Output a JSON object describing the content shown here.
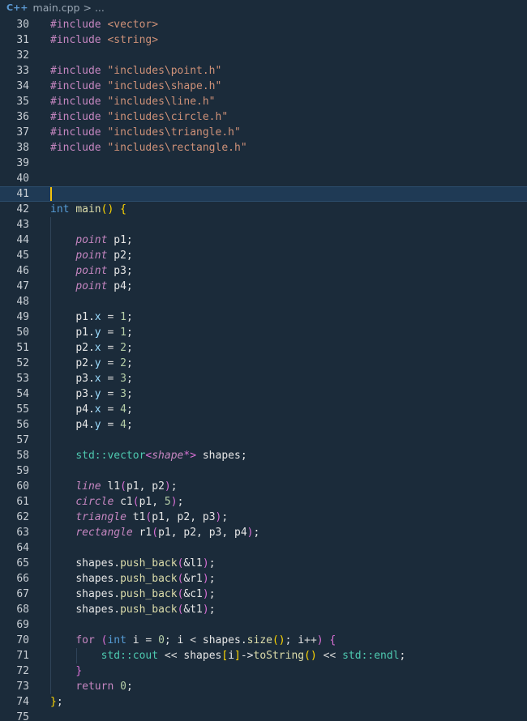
{
  "breadcrumb": {
    "icon": "C++",
    "file": "main.cpp",
    "sep": ">",
    "more": "..."
  },
  "editor": {
    "current_line": 41,
    "lines": [
      {
        "n": "30",
        "tokens": [
          [
            "pp",
            "#include"
          ],
          [
            "op",
            " "
          ],
          [
            "inc",
            "<vector>"
          ]
        ]
      },
      {
        "n": "31",
        "tokens": [
          [
            "pp",
            "#include"
          ],
          [
            "op",
            " "
          ],
          [
            "inc",
            "<string>"
          ]
        ]
      },
      {
        "n": "32",
        "tokens": []
      },
      {
        "n": "33",
        "tokens": [
          [
            "pp",
            "#include"
          ],
          [
            "op",
            " "
          ],
          [
            "incs",
            "\"includes\\point.h\""
          ]
        ]
      },
      {
        "n": "34",
        "tokens": [
          [
            "pp",
            "#include"
          ],
          [
            "op",
            " "
          ],
          [
            "incs",
            "\"includes\\shape.h\""
          ]
        ]
      },
      {
        "n": "35",
        "tokens": [
          [
            "pp",
            "#include"
          ],
          [
            "op",
            " "
          ],
          [
            "incs",
            "\"includes\\line.h\""
          ]
        ]
      },
      {
        "n": "36",
        "tokens": [
          [
            "pp",
            "#include"
          ],
          [
            "op",
            " "
          ],
          [
            "incs",
            "\"includes\\circle.h\""
          ]
        ]
      },
      {
        "n": "37",
        "tokens": [
          [
            "pp",
            "#include"
          ],
          [
            "op",
            " "
          ],
          [
            "incs",
            "\"includes\\triangle.h\""
          ]
        ]
      },
      {
        "n": "38",
        "tokens": [
          [
            "pp",
            "#include"
          ],
          [
            "op",
            " "
          ],
          [
            "incs",
            "\"includes\\rectangle.h\""
          ]
        ]
      },
      {
        "n": "39",
        "tokens": []
      },
      {
        "n": "40",
        "tokens": []
      },
      {
        "n": "41",
        "tokens": []
      },
      {
        "n": "42",
        "tokens": [
          [
            "kwb",
            "int"
          ],
          [
            "op",
            " "
          ],
          [
            "fn",
            "main"
          ],
          [
            "brace",
            "()"
          ],
          [
            "op",
            " "
          ],
          [
            "brace",
            "{"
          ]
        ]
      },
      {
        "n": "43",
        "tokens": []
      },
      {
        "n": "44",
        "tokens": [
          [
            "op",
            "    "
          ],
          [
            "typec",
            "point"
          ],
          [
            "op",
            " "
          ],
          [
            "plain",
            "p1;"
          ]
        ]
      },
      {
        "n": "45",
        "tokens": [
          [
            "op",
            "    "
          ],
          [
            "typec",
            "point"
          ],
          [
            "op",
            " "
          ],
          [
            "plain",
            "p2;"
          ]
        ]
      },
      {
        "n": "46",
        "tokens": [
          [
            "op",
            "    "
          ],
          [
            "typec",
            "point"
          ],
          [
            "op",
            " "
          ],
          [
            "plain",
            "p3;"
          ]
        ]
      },
      {
        "n": "47",
        "tokens": [
          [
            "op",
            "    "
          ],
          [
            "typec",
            "point"
          ],
          [
            "op",
            " "
          ],
          [
            "plain",
            "p4;"
          ]
        ]
      },
      {
        "n": "48",
        "tokens": []
      },
      {
        "n": "49",
        "tokens": [
          [
            "op",
            "    "
          ],
          [
            "plain",
            "p1."
          ],
          [
            "var",
            "x"
          ],
          [
            "op",
            " = "
          ],
          [
            "num",
            "1"
          ],
          [
            "plain",
            ";"
          ]
        ]
      },
      {
        "n": "50",
        "tokens": [
          [
            "op",
            "    "
          ],
          [
            "plain",
            "p1."
          ],
          [
            "var",
            "y"
          ],
          [
            "op",
            " = "
          ],
          [
            "num",
            "1"
          ],
          [
            "plain",
            ";"
          ]
        ]
      },
      {
        "n": "51",
        "tokens": [
          [
            "op",
            "    "
          ],
          [
            "plain",
            "p2."
          ],
          [
            "var",
            "x"
          ],
          [
            "op",
            " = "
          ],
          [
            "num",
            "2"
          ],
          [
            "plain",
            ";"
          ]
        ]
      },
      {
        "n": "52",
        "tokens": [
          [
            "op",
            "    "
          ],
          [
            "plain",
            "p2."
          ],
          [
            "var",
            "y"
          ],
          [
            "op",
            " = "
          ],
          [
            "num",
            "2"
          ],
          [
            "plain",
            ";"
          ]
        ]
      },
      {
        "n": "53",
        "tokens": [
          [
            "op",
            "    "
          ],
          [
            "plain",
            "p3."
          ],
          [
            "var",
            "x"
          ],
          [
            "op",
            " = "
          ],
          [
            "num",
            "3"
          ],
          [
            "plain",
            ";"
          ]
        ]
      },
      {
        "n": "54",
        "tokens": [
          [
            "op",
            "    "
          ],
          [
            "plain",
            "p3."
          ],
          [
            "var",
            "y"
          ],
          [
            "op",
            " = "
          ],
          [
            "num",
            "3"
          ],
          [
            "plain",
            ";"
          ]
        ]
      },
      {
        "n": "55",
        "tokens": [
          [
            "op",
            "    "
          ],
          [
            "plain",
            "p4."
          ],
          [
            "var",
            "x"
          ],
          [
            "op",
            " = "
          ],
          [
            "num",
            "4"
          ],
          [
            "plain",
            ";"
          ]
        ]
      },
      {
        "n": "56",
        "tokens": [
          [
            "op",
            "    "
          ],
          [
            "plain",
            "p4."
          ],
          [
            "var",
            "y"
          ],
          [
            "op",
            " = "
          ],
          [
            "num",
            "4"
          ],
          [
            "plain",
            ";"
          ]
        ]
      },
      {
        "n": "57",
        "tokens": []
      },
      {
        "n": "58",
        "tokens": [
          [
            "op",
            "    "
          ],
          [
            "ns",
            "std::vector"
          ],
          [
            "paren",
            "<"
          ],
          [
            "typec",
            "shape"
          ],
          [
            "paren",
            "*>"
          ],
          [
            "op",
            " "
          ],
          [
            "plain",
            "shapes;"
          ]
        ]
      },
      {
        "n": "59",
        "tokens": []
      },
      {
        "n": "60",
        "tokens": [
          [
            "op",
            "    "
          ],
          [
            "typec",
            "line"
          ],
          [
            "op",
            " "
          ],
          [
            "plain",
            "l1"
          ],
          [
            "paren",
            "("
          ],
          [
            "plain",
            "p1, p2"
          ],
          [
            "paren",
            ")"
          ],
          [
            "plain",
            ";"
          ]
        ]
      },
      {
        "n": "61",
        "tokens": [
          [
            "op",
            "    "
          ],
          [
            "typec",
            "circle"
          ],
          [
            "op",
            " "
          ],
          [
            "plain",
            "c1"
          ],
          [
            "paren",
            "("
          ],
          [
            "plain",
            "p1, "
          ],
          [
            "num",
            "5"
          ],
          [
            "paren",
            ")"
          ],
          [
            "plain",
            ";"
          ]
        ]
      },
      {
        "n": "62",
        "tokens": [
          [
            "op",
            "    "
          ],
          [
            "typec",
            "triangle"
          ],
          [
            "op",
            " "
          ],
          [
            "plain",
            "t1"
          ],
          [
            "paren",
            "("
          ],
          [
            "plain",
            "p1, p2, p3"
          ],
          [
            "paren",
            ")"
          ],
          [
            "plain",
            ";"
          ]
        ]
      },
      {
        "n": "63",
        "tokens": [
          [
            "op",
            "    "
          ],
          [
            "typec",
            "rectangle"
          ],
          [
            "op",
            " "
          ],
          [
            "plain",
            "r1"
          ],
          [
            "paren",
            "("
          ],
          [
            "plain",
            "p1, p2, p3, p4"
          ],
          [
            "paren",
            ")"
          ],
          [
            "plain",
            ";"
          ]
        ]
      },
      {
        "n": "64",
        "tokens": []
      },
      {
        "n": "65",
        "tokens": [
          [
            "op",
            "    "
          ],
          [
            "plain",
            "shapes."
          ],
          [
            "fn",
            "push_back"
          ],
          [
            "paren",
            "("
          ],
          [
            "plain",
            "&l1"
          ],
          [
            "paren",
            ")"
          ],
          [
            "plain",
            ";"
          ]
        ]
      },
      {
        "n": "66",
        "tokens": [
          [
            "op",
            "    "
          ],
          [
            "plain",
            "shapes."
          ],
          [
            "fn",
            "push_back"
          ],
          [
            "paren",
            "("
          ],
          [
            "plain",
            "&r1"
          ],
          [
            "paren",
            ")"
          ],
          [
            "plain",
            ";"
          ]
        ]
      },
      {
        "n": "67",
        "tokens": [
          [
            "op",
            "    "
          ],
          [
            "plain",
            "shapes."
          ],
          [
            "fn",
            "push_back"
          ],
          [
            "paren",
            "("
          ],
          [
            "plain",
            "&c1"
          ],
          [
            "paren",
            ")"
          ],
          [
            "plain",
            ";"
          ]
        ]
      },
      {
        "n": "68",
        "tokens": [
          [
            "op",
            "    "
          ],
          [
            "plain",
            "shapes."
          ],
          [
            "fn",
            "push_back"
          ],
          [
            "paren",
            "("
          ],
          [
            "plain",
            "&t1"
          ],
          [
            "paren",
            ")"
          ],
          [
            "plain",
            ";"
          ]
        ]
      },
      {
        "n": "69",
        "tokens": []
      },
      {
        "n": "70",
        "tokens": [
          [
            "op",
            "    "
          ],
          [
            "kw",
            "for"
          ],
          [
            "op",
            " "
          ],
          [
            "paren",
            "("
          ],
          [
            "kwb",
            "int"
          ],
          [
            "plain",
            " i "
          ],
          [
            "op",
            "="
          ],
          [
            "op",
            " "
          ],
          [
            "num",
            "0"
          ],
          [
            "plain",
            "; i "
          ],
          [
            "op",
            "<"
          ],
          [
            "plain",
            " shapes."
          ],
          [
            "fn",
            "size"
          ],
          [
            "brace",
            "()"
          ],
          [
            "plain",
            "; i"
          ],
          [
            "op",
            "++"
          ],
          [
            "paren",
            ")"
          ],
          [
            "op",
            " "
          ],
          [
            "paren",
            "{"
          ]
        ]
      },
      {
        "n": "71",
        "tokens": [
          [
            "op",
            "        "
          ],
          [
            "ns",
            "std::cout"
          ],
          [
            "op",
            " << "
          ],
          [
            "plain",
            "shapes"
          ],
          [
            "brace",
            "["
          ],
          [
            "plain",
            "i"
          ],
          [
            "brace",
            "]"
          ],
          [
            "plain",
            "->"
          ],
          [
            "fn",
            "toString"
          ],
          [
            "brace",
            "()"
          ],
          [
            "op",
            " << "
          ],
          [
            "ns",
            "std::endl"
          ],
          [
            "plain",
            ";"
          ]
        ]
      },
      {
        "n": "72",
        "tokens": [
          [
            "op",
            "    "
          ],
          [
            "paren",
            "}"
          ]
        ]
      },
      {
        "n": "73",
        "tokens": [
          [
            "op",
            "    "
          ],
          [
            "kw",
            "return"
          ],
          [
            "op",
            " "
          ],
          [
            "num",
            "0"
          ],
          [
            "plain",
            ";"
          ]
        ]
      },
      {
        "n": "74",
        "tokens": [
          [
            "brace",
            "}"
          ],
          [
            "plain",
            ";"
          ]
        ]
      },
      {
        "n": "75",
        "tokens": []
      }
    ]
  }
}
